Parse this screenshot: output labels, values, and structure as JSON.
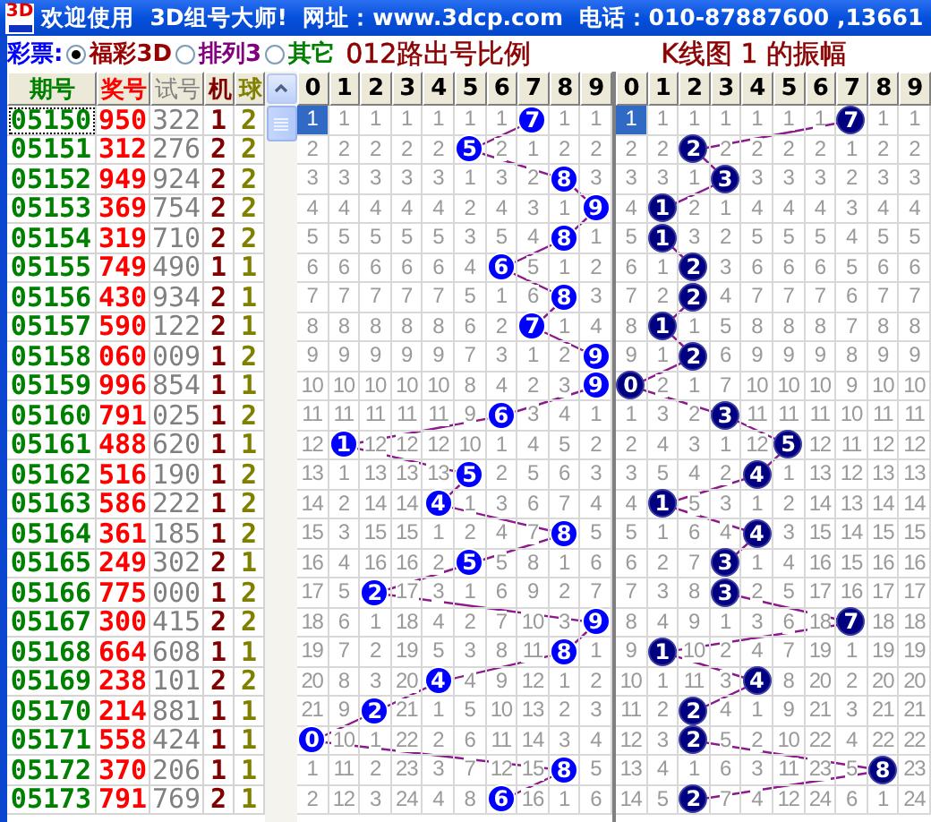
{
  "window": {
    "logo": "3D",
    "title": "欢迎使用  3D组号大师!  网址：www.3dcp.com  电话：010-87887600 ,13661"
  },
  "lottery": {
    "label": "彩票:",
    "options": [
      {
        "label": "福彩3D",
        "selected": true
      },
      {
        "label": "排列3",
        "selected": false
      },
      {
        "label": "其它",
        "selected": false
      }
    ]
  },
  "table": {
    "columns": [
      "期号",
      "奖号",
      "试号",
      "机",
      "球"
    ],
    "rows": [
      {
        "period": "05150",
        "draw": "950",
        "trial": "322",
        "machine": "1",
        "ball": "2",
        "selected": true
      },
      {
        "period": "05151",
        "draw": "312",
        "trial": "276",
        "machine": "2",
        "ball": "2",
        "selected": false
      },
      {
        "period": "05152",
        "draw": "949",
        "trial": "924",
        "machine": "2",
        "ball": "2",
        "selected": false
      },
      {
        "period": "05153",
        "draw": "369",
        "trial": "754",
        "machine": "2",
        "ball": "2",
        "selected": false
      },
      {
        "period": "05154",
        "draw": "319",
        "trial": "710",
        "machine": "2",
        "ball": "2",
        "selected": false
      },
      {
        "period": "05155",
        "draw": "749",
        "trial": "490",
        "machine": "1",
        "ball": "1",
        "selected": false
      },
      {
        "period": "05156",
        "draw": "430",
        "trial": "934",
        "machine": "2",
        "ball": "1",
        "selected": false
      },
      {
        "period": "05157",
        "draw": "590",
        "trial": "122",
        "machine": "2",
        "ball": "1",
        "selected": false
      },
      {
        "period": "05158",
        "draw": "060",
        "trial": "009",
        "machine": "1",
        "ball": "2",
        "selected": false
      },
      {
        "period": "05159",
        "draw": "996",
        "trial": "854",
        "machine": "1",
        "ball": "1",
        "selected": false
      },
      {
        "period": "05160",
        "draw": "791",
        "trial": "025",
        "machine": "1",
        "ball": "2",
        "selected": false
      },
      {
        "period": "05161",
        "draw": "488",
        "trial": "620",
        "machine": "1",
        "ball": "1",
        "selected": false
      },
      {
        "period": "05162",
        "draw": "516",
        "trial": "190",
        "machine": "1",
        "ball": "2",
        "selected": false
      },
      {
        "period": "05163",
        "draw": "586",
        "trial": "222",
        "machine": "1",
        "ball": "2",
        "selected": false
      },
      {
        "period": "05164",
        "draw": "361",
        "trial": "185",
        "machine": "1",
        "ball": "2",
        "selected": false
      },
      {
        "period": "05165",
        "draw": "249",
        "trial": "302",
        "machine": "2",
        "ball": "1",
        "selected": false
      },
      {
        "period": "05166",
        "draw": "775",
        "trial": "000",
        "machine": "1",
        "ball": "2",
        "selected": false
      },
      {
        "period": "05167",
        "draw": "300",
        "trial": "415",
        "machine": "2",
        "ball": "2",
        "selected": false
      },
      {
        "period": "05168",
        "draw": "664",
        "trial": "608",
        "machine": "1",
        "ball": "1",
        "selected": false
      },
      {
        "period": "05169",
        "draw": "238",
        "trial": "101",
        "machine": "2",
        "ball": "2",
        "selected": false
      },
      {
        "period": "05170",
        "draw": "214",
        "trial": "881",
        "machine": "1",
        "ball": "1",
        "selected": false
      },
      {
        "period": "05171",
        "draw": "558",
        "trial": "424",
        "machine": "1",
        "ball": "1",
        "selected": false
      },
      {
        "period": "05172",
        "draw": "370",
        "trial": "206",
        "machine": "1",
        "ball": "1",
        "selected": false
      },
      {
        "period": "05173",
        "draw": "791",
        "trial": "769",
        "machine": "2",
        "ball": "1",
        "selected": false
      }
    ]
  },
  "charts": [
    {
      "title": "012路出号比例",
      "columns": [
        "0",
        "1",
        "2",
        "3",
        "4",
        "5",
        "6",
        "7",
        "8",
        "9"
      ],
      "rows": [
        {
          "cells": [
            "1",
            "1",
            "1",
            "1",
            "1",
            "1",
            "1",
            "7",
            "1",
            "1"
          ],
          "hits": [
            false,
            false,
            false,
            false,
            false,
            false,
            false,
            true,
            false,
            false
          ]
        },
        {
          "cells": [
            "2",
            "2",
            "2",
            "2",
            "2",
            "5",
            "2",
            "1",
            "2",
            "2"
          ],
          "hits": [
            false,
            false,
            false,
            false,
            false,
            true,
            false,
            false,
            false,
            false
          ]
        },
        {
          "cells": [
            "3",
            "3",
            "3",
            "3",
            "3",
            "1",
            "3",
            "2",
            "8",
            "3"
          ],
          "hits": [
            false,
            false,
            false,
            false,
            false,
            false,
            false,
            false,
            true,
            false
          ]
        },
        {
          "cells": [
            "4",
            "4",
            "4",
            "4",
            "4",
            "2",
            "4",
            "3",
            "1",
            "9"
          ],
          "hits": [
            false,
            false,
            false,
            false,
            false,
            false,
            false,
            false,
            false,
            true
          ]
        },
        {
          "cells": [
            "5",
            "5",
            "5",
            "5",
            "5",
            "3",
            "5",
            "4",
            "8",
            "1"
          ],
          "hits": [
            false,
            false,
            false,
            false,
            false,
            false,
            false,
            false,
            true,
            false
          ]
        },
        {
          "cells": [
            "6",
            "6",
            "6",
            "6",
            "6",
            "4",
            "6",
            "5",
            "1",
            "2"
          ],
          "hits": [
            false,
            false,
            false,
            false,
            false,
            false,
            true,
            false,
            false,
            false
          ]
        },
        {
          "cells": [
            "7",
            "7",
            "7",
            "7",
            "7",
            "5",
            "1",
            "6",
            "8",
            "3"
          ],
          "hits": [
            false,
            false,
            false,
            false,
            false,
            false,
            false,
            false,
            true,
            false
          ]
        },
        {
          "cells": [
            "8",
            "8",
            "8",
            "8",
            "8",
            "6",
            "2",
            "7",
            "1",
            "4"
          ],
          "hits": [
            false,
            false,
            false,
            false,
            false,
            false,
            false,
            true,
            false,
            false
          ]
        },
        {
          "cells": [
            "9",
            "9",
            "9",
            "9",
            "9",
            "7",
            "3",
            "1",
            "2",
            "9"
          ],
          "hits": [
            false,
            false,
            false,
            false,
            false,
            false,
            false,
            false,
            false,
            true
          ]
        },
        {
          "cells": [
            "10",
            "10",
            "10",
            "10",
            "10",
            "8",
            "4",
            "2",
            "3",
            "9"
          ],
          "hits": [
            false,
            false,
            false,
            false,
            false,
            false,
            false,
            false,
            false,
            true
          ]
        },
        {
          "cells": [
            "11",
            "11",
            "11",
            "11",
            "11",
            "9",
            "6",
            "3",
            "4",
            "1"
          ],
          "hits": [
            false,
            false,
            false,
            false,
            false,
            false,
            true,
            false,
            false,
            false
          ]
        },
        {
          "cells": [
            "12",
            "1",
            "12",
            "12",
            "12",
            "10",
            "1",
            "4",
            "5",
            "2"
          ],
          "hits": [
            false,
            true,
            false,
            false,
            false,
            false,
            false,
            false,
            false,
            false
          ]
        },
        {
          "cells": [
            "13",
            "1",
            "13",
            "13",
            "13",
            "5",
            "2",
            "5",
            "6",
            "3"
          ],
          "hits": [
            false,
            false,
            false,
            false,
            false,
            true,
            false,
            false,
            false,
            false
          ]
        },
        {
          "cells": [
            "14",
            "2",
            "14",
            "14",
            "4",
            "1",
            "3",
            "6",
            "7",
            "4"
          ],
          "hits": [
            false,
            false,
            false,
            false,
            true,
            false,
            false,
            false,
            false,
            false
          ]
        },
        {
          "cells": [
            "15",
            "3",
            "15",
            "15",
            "1",
            "2",
            "4",
            "7",
            "8",
            "5"
          ],
          "hits": [
            false,
            false,
            false,
            false,
            false,
            false,
            false,
            false,
            true,
            false
          ]
        },
        {
          "cells": [
            "16",
            "4",
            "16",
            "16",
            "2",
            "5",
            "5",
            "8",
            "1",
            "6"
          ],
          "hits": [
            false,
            false,
            false,
            false,
            false,
            true,
            false,
            false,
            false,
            false
          ]
        },
        {
          "cells": [
            "17",
            "5",
            "2",
            "17",
            "3",
            "1",
            "6",
            "9",
            "2",
            "7"
          ],
          "hits": [
            false,
            false,
            true,
            false,
            false,
            false,
            false,
            false,
            false,
            false
          ]
        },
        {
          "cells": [
            "18",
            "6",
            "1",
            "18",
            "4",
            "2",
            "7",
            "10",
            "3",
            "9"
          ],
          "hits": [
            false,
            false,
            false,
            false,
            false,
            false,
            false,
            false,
            false,
            true
          ]
        },
        {
          "cells": [
            "19",
            "7",
            "2",
            "19",
            "5",
            "3",
            "8",
            "11",
            "8",
            "1"
          ],
          "hits": [
            false,
            false,
            false,
            false,
            false,
            false,
            false,
            false,
            true,
            false
          ]
        },
        {
          "cells": [
            "20",
            "8",
            "3",
            "20",
            "4",
            "4",
            "9",
            "12",
            "1",
            "2"
          ],
          "hits": [
            false,
            false,
            false,
            false,
            true,
            false,
            false,
            false,
            false,
            false
          ]
        },
        {
          "cells": [
            "21",
            "9",
            "2",
            "21",
            "1",
            "5",
            "10",
            "13",
            "2",
            "3"
          ],
          "hits": [
            false,
            false,
            true,
            false,
            false,
            false,
            false,
            false,
            false,
            false
          ]
        },
        {
          "cells": [
            "0",
            "10",
            "1",
            "22",
            "2",
            "6",
            "11",
            "14",
            "3",
            "4"
          ],
          "hits": [
            true,
            false,
            false,
            false,
            false,
            false,
            false,
            false,
            false,
            false
          ]
        },
        {
          "cells": [
            "1",
            "11",
            "2",
            "23",
            "3",
            "7",
            "12",
            "15",
            "8",
            "5"
          ],
          "hits": [
            false,
            false,
            false,
            false,
            false,
            false,
            false,
            false,
            true,
            false
          ]
        },
        {
          "cells": [
            "2",
            "12",
            "3",
            "24",
            "4",
            "8",
            "6",
            "16",
            "1",
            "6"
          ],
          "hits": [
            false,
            false,
            false,
            false,
            false,
            false,
            true,
            false,
            false,
            false
          ]
        }
      ]
    },
    {
      "title": "K线图 1 的振幅",
      "columns": [
        "0",
        "1",
        "2",
        "3",
        "4",
        "5",
        "6",
        "7",
        "8",
        "9"
      ],
      "rows": [
        {
          "cells": [
            "1",
            "1",
            "1",
            "1",
            "1",
            "1",
            "1",
            "7",
            "1",
            "1"
          ],
          "hits": [
            false,
            false,
            false,
            false,
            false,
            false,
            false,
            true,
            false,
            false
          ]
        },
        {
          "cells": [
            "2",
            "2",
            "2",
            "2",
            "2",
            "2",
            "2",
            "1",
            "2",
            "2"
          ],
          "hits": [
            false,
            false,
            true,
            false,
            false,
            false,
            false,
            false,
            false,
            false
          ]
        },
        {
          "cells": [
            "3",
            "3",
            "1",
            "3",
            "3",
            "3",
            "3",
            "2",
            "3",
            "3"
          ],
          "hits": [
            false,
            false,
            false,
            true,
            false,
            false,
            false,
            false,
            false,
            false
          ]
        },
        {
          "cells": [
            "4",
            "1",
            "2",
            "1",
            "4",
            "4",
            "4",
            "3",
            "4",
            "4"
          ],
          "hits": [
            false,
            true,
            false,
            false,
            false,
            false,
            false,
            false,
            false,
            false
          ]
        },
        {
          "cells": [
            "5",
            "1",
            "3",
            "2",
            "5",
            "5",
            "5",
            "4",
            "5",
            "5"
          ],
          "hits": [
            false,
            true,
            false,
            false,
            false,
            false,
            false,
            false,
            false,
            false
          ]
        },
        {
          "cells": [
            "6",
            "1",
            "2",
            "3",
            "6",
            "6",
            "6",
            "5",
            "6",
            "6"
          ],
          "hits": [
            false,
            false,
            true,
            false,
            false,
            false,
            false,
            false,
            false,
            false
          ]
        },
        {
          "cells": [
            "7",
            "2",
            "2",
            "4",
            "7",
            "7",
            "7",
            "6",
            "7",
            "7"
          ],
          "hits": [
            false,
            false,
            true,
            false,
            false,
            false,
            false,
            false,
            false,
            false
          ]
        },
        {
          "cells": [
            "8",
            "1",
            "1",
            "5",
            "8",
            "8",
            "8",
            "7",
            "8",
            "8"
          ],
          "hits": [
            false,
            true,
            false,
            false,
            false,
            false,
            false,
            false,
            false,
            false
          ]
        },
        {
          "cells": [
            "9",
            "1",
            "2",
            "6",
            "9",
            "9",
            "9",
            "8",
            "9",
            "9"
          ],
          "hits": [
            false,
            false,
            true,
            false,
            false,
            false,
            false,
            false,
            false,
            false
          ]
        },
        {
          "cells": [
            "0",
            "2",
            "1",
            "7",
            "10",
            "10",
            "10",
            "9",
            "10",
            "10"
          ],
          "hits": [
            true,
            false,
            false,
            false,
            false,
            false,
            false,
            false,
            false,
            false
          ]
        },
        {
          "cells": [
            "1",
            "3",
            "2",
            "3",
            "11",
            "11",
            "11",
            "10",
            "11",
            "11"
          ],
          "hits": [
            false,
            false,
            false,
            true,
            false,
            false,
            false,
            false,
            false,
            false
          ]
        },
        {
          "cells": [
            "2",
            "4",
            "3",
            "1",
            "12",
            "5",
            "12",
            "11",
            "12",
            "12"
          ],
          "hits": [
            false,
            false,
            false,
            false,
            false,
            true,
            false,
            false,
            false,
            false
          ]
        },
        {
          "cells": [
            "3",
            "5",
            "4",
            "2",
            "4",
            "1",
            "13",
            "12",
            "13",
            "13"
          ],
          "hits": [
            false,
            false,
            false,
            false,
            true,
            false,
            false,
            false,
            false,
            false
          ]
        },
        {
          "cells": [
            "4",
            "1",
            "5",
            "3",
            "1",
            "2",
            "14",
            "13",
            "14",
            "14"
          ],
          "hits": [
            false,
            true,
            false,
            false,
            false,
            false,
            false,
            false,
            false,
            false
          ]
        },
        {
          "cells": [
            "5",
            "1",
            "6",
            "4",
            "4",
            "3",
            "15",
            "14",
            "15",
            "15"
          ],
          "hits": [
            false,
            false,
            false,
            false,
            true,
            false,
            false,
            false,
            false,
            false
          ]
        },
        {
          "cells": [
            "6",
            "2",
            "7",
            "3",
            "1",
            "4",
            "16",
            "15",
            "16",
            "16"
          ],
          "hits": [
            false,
            false,
            false,
            true,
            false,
            false,
            false,
            false,
            false,
            false
          ]
        },
        {
          "cells": [
            "7",
            "3",
            "8",
            "3",
            "2",
            "5",
            "17",
            "16",
            "17",
            "17"
          ],
          "hits": [
            false,
            false,
            false,
            true,
            false,
            false,
            false,
            false,
            false,
            false
          ]
        },
        {
          "cells": [
            "8",
            "4",
            "9",
            "1",
            "3",
            "6",
            "18",
            "7",
            "18",
            "18"
          ],
          "hits": [
            false,
            false,
            false,
            false,
            false,
            false,
            false,
            true,
            false,
            false
          ]
        },
        {
          "cells": [
            "9",
            "1",
            "10",
            "2",
            "4",
            "7",
            "19",
            "1",
            "19",
            "19"
          ],
          "hits": [
            false,
            true,
            false,
            false,
            false,
            false,
            false,
            false,
            false,
            false
          ]
        },
        {
          "cells": [
            "10",
            "1",
            "11",
            "3",
            "4",
            "8",
            "20",
            "2",
            "20",
            "20"
          ],
          "hits": [
            false,
            false,
            false,
            false,
            true,
            false,
            false,
            false,
            false,
            false
          ]
        },
        {
          "cells": [
            "11",
            "2",
            "2",
            "4",
            "1",
            "9",
            "21",
            "3",
            "21",
            "21"
          ],
          "hits": [
            false,
            false,
            true,
            false,
            false,
            false,
            false,
            false,
            false,
            false
          ]
        },
        {
          "cells": [
            "12",
            "3",
            "2",
            "5",
            "2",
            "10",
            "22",
            "4",
            "22",
            "22"
          ],
          "hits": [
            false,
            false,
            true,
            false,
            false,
            false,
            false,
            false,
            false,
            false
          ]
        },
        {
          "cells": [
            "13",
            "4",
            "1",
            "6",
            "3",
            "11",
            "23",
            "5",
            "8",
            "23"
          ],
          "hits": [
            false,
            false,
            false,
            false,
            false,
            false,
            false,
            false,
            true,
            false
          ]
        },
        {
          "cells": [
            "14",
            "5",
            "2",
            "7",
            "4",
            "12",
            "24",
            "6",
            "1",
            "24"
          ],
          "hits": [
            false,
            false,
            true,
            false,
            false,
            false,
            false,
            false,
            false,
            false
          ]
        }
      ]
    }
  ]
}
